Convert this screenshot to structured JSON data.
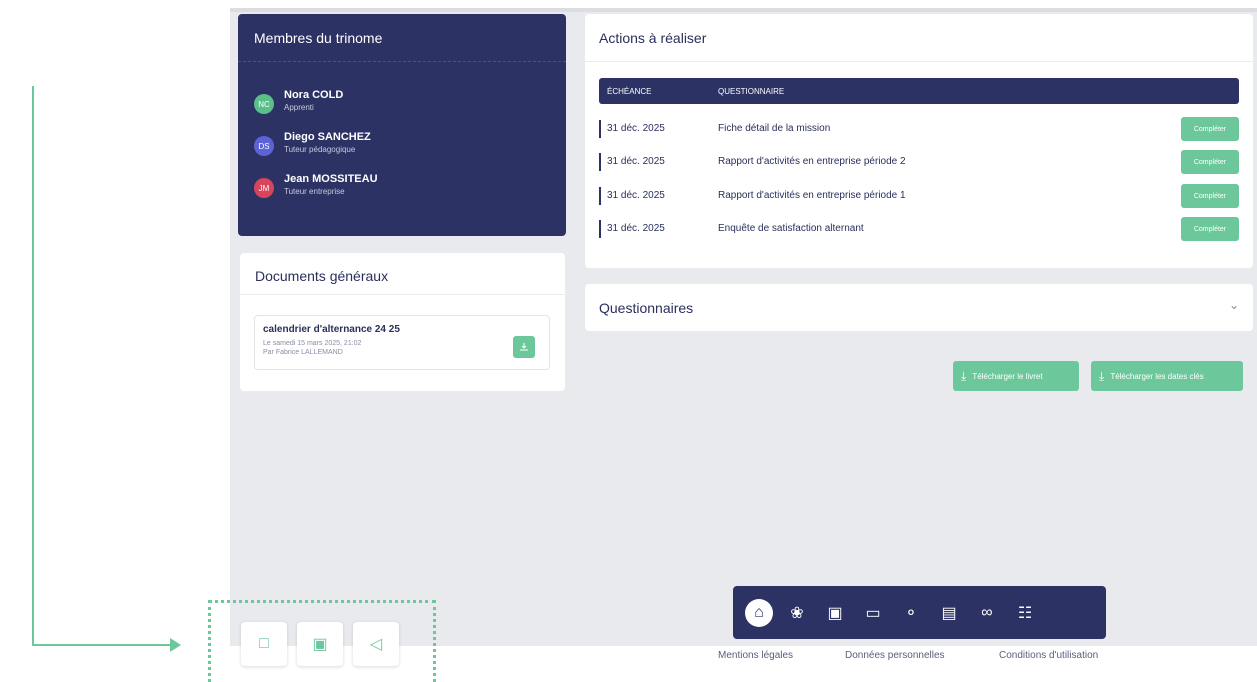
{
  "trinome": {
    "title": "Membres du trinome",
    "members": [
      {
        "initials": "NC",
        "name": "Nora COLD",
        "role": "Apprenti",
        "color": "#5bbf8a"
      },
      {
        "initials": "DS",
        "name": "Diego SANCHEZ",
        "role": "Tuteur pédagogique",
        "color": "#5b63d6"
      },
      {
        "initials": "JM",
        "name": "Jean MOSSITEAU",
        "role": "Tuteur entreprise",
        "color": "#d6455a"
      }
    ]
  },
  "documents": {
    "title": "Documents généraux",
    "item": {
      "title": "calendrier d'alternance 24 25",
      "date": "Le samedi 15 mars 2025, 21:02",
      "author": "Par Fabrice LALLEMAND"
    }
  },
  "actions": {
    "title": "Actions à réaliser",
    "columns": [
      "ÉCHÉANCE",
      "QUESTIONNAIRE"
    ],
    "rows": [
      {
        "date": "31 déc. 2025",
        "questionnaire": "Fiche détail de la mission",
        "button": "Compléter"
      },
      {
        "date": "31 déc. 2025",
        "questionnaire": "Rapport d'activités en entreprise période 2",
        "button": "Compléter"
      },
      {
        "date": "31 déc. 2025",
        "questionnaire": "Rapport d'activités en entreprise période 1",
        "button": "Compléter"
      },
      {
        "date": "31 déc. 2025",
        "questionnaire": "Enquête de satisfaction alternant",
        "button": "Compléter"
      }
    ]
  },
  "questionnaires": {
    "title": "Questionnaires"
  },
  "downloads": {
    "livret": "Télécharger le livret",
    "dates": "Télécharger les dates clés"
  },
  "footer": {
    "mentions": "Mentions légales",
    "donnees": "Données personnelles",
    "conditions": "Conditions d'utilisation"
  },
  "colors": {
    "navy": "#2c3263",
    "green": "#6cc79a"
  }
}
